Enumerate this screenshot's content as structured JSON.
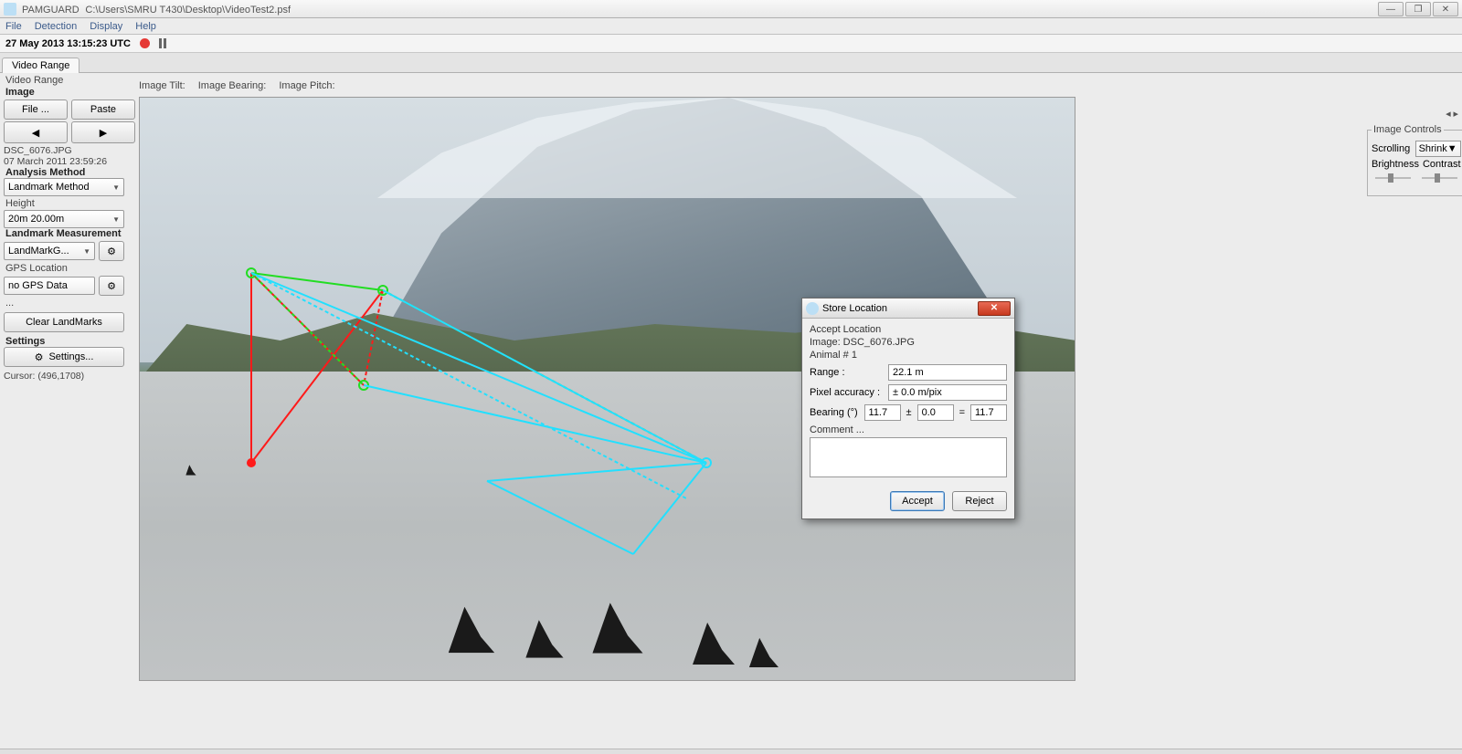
{
  "titlebar": {
    "app": "PAMGUARD",
    "path": "C:\\Users\\SMRU T430\\Desktop\\VideoTest2.psf"
  },
  "menu": {
    "file": "File",
    "detection": "Detection",
    "display": "Display",
    "help": "Help"
  },
  "timestrip": {
    "timestamp": "27 May 2013 13:15:23 UTC"
  },
  "tabs": {
    "video_range": "Video Range"
  },
  "left": {
    "section_label": "Video Range",
    "image_hdr": "Image",
    "file_btn": "File ...",
    "paste_btn": "Paste",
    "filename": "DSC_6076.JPG",
    "file_time": "07 March 2011 23:59:26",
    "analysis_hdr": "Analysis Method",
    "analysis_value": "Landmark Method",
    "height_lbl": "Height",
    "height_value": "20m 20.00m",
    "landmark_hdr": "Landmark Measurement",
    "landmark_value": "LandMarkG...",
    "gps_lbl": "GPS Location",
    "gps_value": "no GPS Data",
    "dots": "...",
    "clear_btn": "Clear LandMarks",
    "settings_hdr": "Settings",
    "settings_btn": "Settings...",
    "cursor": "Cursor: (496,1708)"
  },
  "imgheader": {
    "tilt": "Image Tilt:",
    "bearing": "Image Bearing:",
    "pitch": "Image Pitch:"
  },
  "right": {
    "group": "Image Controls",
    "scrolling": "Scrolling",
    "shrink": "Shrink",
    "brightness": "Brightness",
    "contrast": "Contrast"
  },
  "dialog": {
    "title": "Store Location",
    "accept_loc": "Accept Location",
    "image_line": "Image: DSC_6076.JPG",
    "animal_line": "Animal # 1",
    "range_lbl": "Range :",
    "range_val": "22.1 m",
    "pix_lbl": "Pixel accuracy :",
    "pix_val": "± 0.0 m/pix",
    "bearing_lbl": "Bearing (°)",
    "bearing_a": "11.7",
    "bearing_b": "0.0",
    "bearing_c": "11.7",
    "pm": "±",
    "eq": "=",
    "comment_lbl": "Comment ...",
    "accept": "Accept",
    "reject": "Reject"
  }
}
